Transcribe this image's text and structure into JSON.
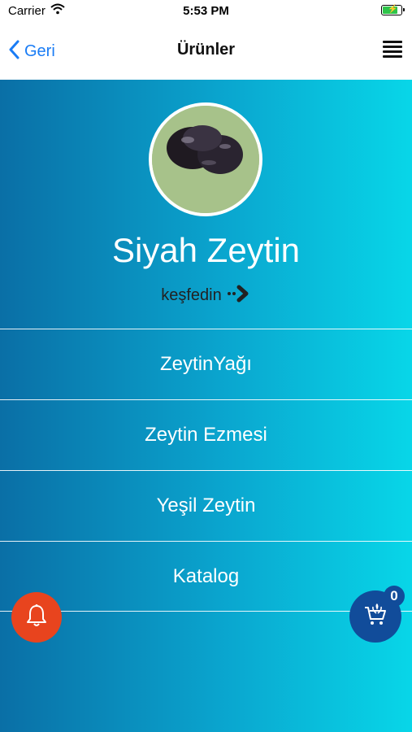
{
  "status_bar": {
    "carrier": "Carrier",
    "time": "5:53 PM"
  },
  "nav": {
    "back_label": "Geri",
    "title": "Ürünler"
  },
  "product": {
    "name": "Siyah Zeytin",
    "discover_label": "keşfedin"
  },
  "menu": {
    "items": [
      {
        "label": "ZeytinYağı"
      },
      {
        "label": "Zeytin Ezmesi"
      },
      {
        "label": "Yeşil Zeytin"
      },
      {
        "label": "Katalog"
      }
    ]
  },
  "cart": {
    "count": "0"
  },
  "colors": {
    "accent": "#1a7cf5",
    "bell": "#e8441e",
    "cart": "#114c9a",
    "gradient_start": "#0a6fa6",
    "gradient_end": "#08d6e8"
  },
  "icons": {
    "back": "chevron-left-icon",
    "menu": "hamburger-menu-icon",
    "discover": "arrow-right-icon",
    "bell": "bell-icon",
    "cart": "cart-icon"
  }
}
